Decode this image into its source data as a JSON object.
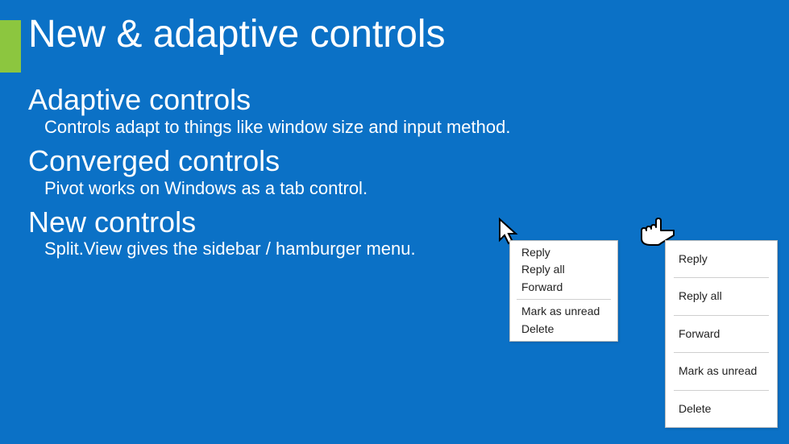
{
  "title": "New & adaptive controls",
  "sections": [
    {
      "heading": "Adaptive controls",
      "body": "Controls adapt to things like window size and input method."
    },
    {
      "heading": "Converged controls",
      "body": "Pivot works on Windows as a tab control."
    },
    {
      "heading": "New controls",
      "body": "Split.View gives the sidebar / hamburger menu."
    }
  ],
  "menus": {
    "mouse": {
      "items_top": [
        "Reply",
        "Reply all",
        "Forward"
      ],
      "items_bottom": [
        "Mark as unread",
        "Delete"
      ]
    },
    "touch": {
      "group1": [
        "Reply"
      ],
      "group2": [
        "Reply all"
      ],
      "group3": [
        "Forward"
      ],
      "group4": [
        "Mark as unread"
      ],
      "group5": [
        "Delete"
      ]
    }
  },
  "colors": {
    "background": "#0b71c6",
    "accent": "#8cc63f",
    "text": "#ffffff",
    "menu_bg": "#ffffff",
    "menu_text": "#222222",
    "menu_border": "#bdbdbd"
  }
}
